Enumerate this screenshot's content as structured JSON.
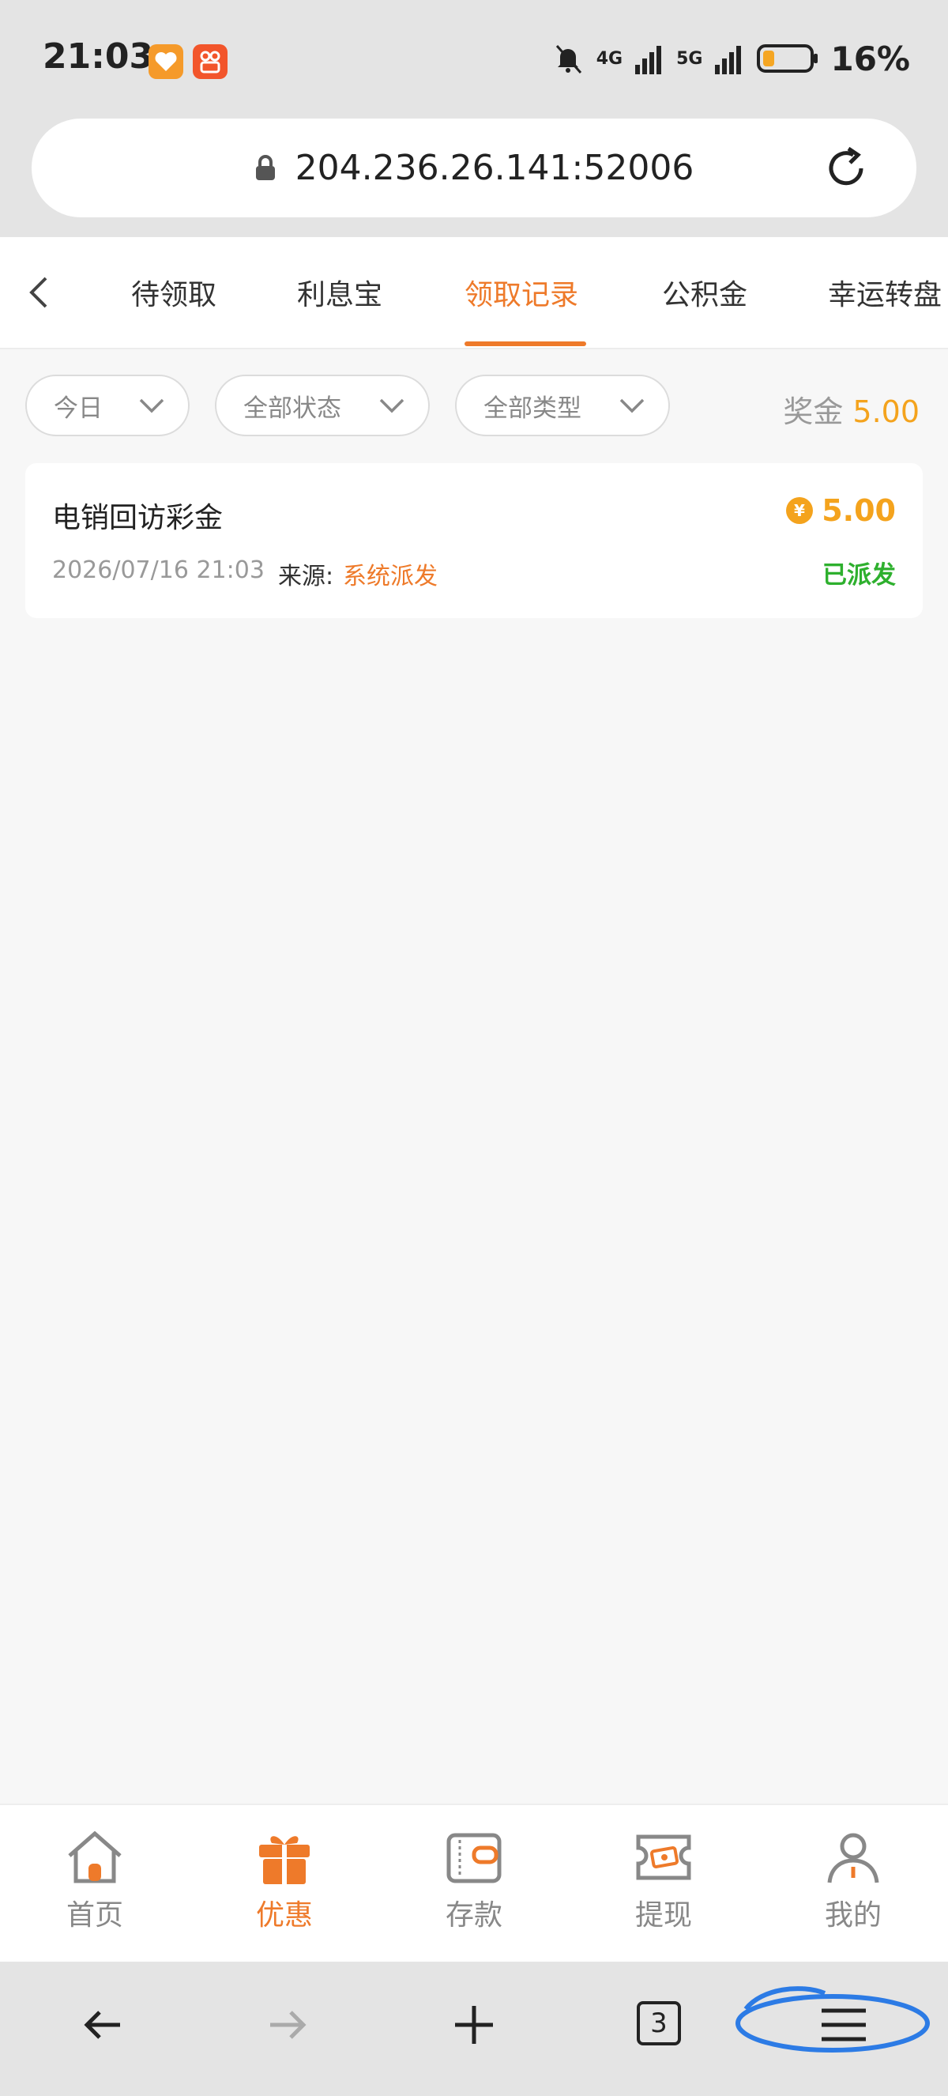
{
  "statusbar": {
    "time": "21:03",
    "battery": "16%",
    "network1": "4G",
    "network2": "5G"
  },
  "browser": {
    "url": "204.236.26.141:52006",
    "tab_count": "3"
  },
  "tabs": [
    {
      "label": "待领取"
    },
    {
      "label": "利息宝"
    },
    {
      "label": "领取记录",
      "active": true
    },
    {
      "label": "公积金"
    },
    {
      "label": "幸运转盘"
    }
  ],
  "filters": {
    "date": "今日",
    "status": "全部状态",
    "type": "全部类型",
    "bonus_label": "奖金",
    "bonus_amount": "5.00"
  },
  "records": [
    {
      "title": "电销回访彩金",
      "amount": "5.00",
      "datetime": "2026/07/16 21:03",
      "source_label": "来源:",
      "source": "系统派发",
      "status": "已派发"
    }
  ],
  "bottom_nav": [
    {
      "label": "首页",
      "icon": "home-icon"
    },
    {
      "label": "优惠",
      "icon": "gift-icon",
      "active": true
    },
    {
      "label": "存款",
      "icon": "wallet-icon"
    },
    {
      "label": "提现",
      "icon": "withdraw-icon"
    },
    {
      "label": "我的",
      "icon": "user-icon"
    }
  ],
  "colors": {
    "accent": "#ee7a2a",
    "gold": "#f4a31d",
    "success": "#2eb02e"
  }
}
